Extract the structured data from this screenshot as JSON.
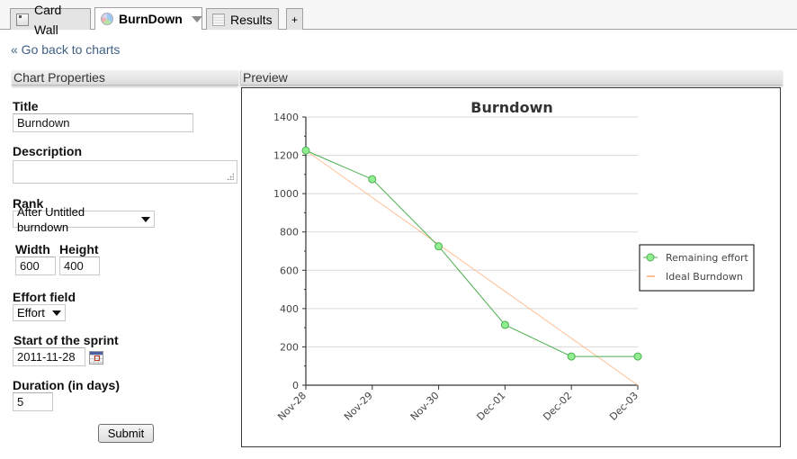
{
  "tabs": [
    {
      "label": "Card Wall",
      "icon": "card-icon",
      "active": false
    },
    {
      "label": "BurnDown",
      "icon": "pie-chart-icon",
      "active": true
    },
    {
      "label": "Results",
      "icon": "table-icon",
      "active": false
    },
    {
      "label": "+",
      "icon": "add-icon",
      "active": false
    }
  ],
  "back_link": "« Go back to charts",
  "sections": {
    "properties": "Chart Properties",
    "preview": "Preview"
  },
  "form": {
    "title_label": "Title",
    "title_value": "Burndown",
    "description_label": "Description",
    "description_value": "",
    "rank_label": "Rank",
    "rank_value": "After Untitled burndown",
    "width_label": "Width",
    "width_value": "600",
    "height_label": "Height",
    "height_value": "400",
    "effort_label": "Effort field",
    "effort_value": "Effort",
    "start_label": "Start of the sprint",
    "start_value": "2011-11-28",
    "duration_label": "Duration (in days)",
    "duration_value": "5",
    "submit_label": "Submit"
  },
  "colors": {
    "remaining": "#4caf50",
    "remaining_marker": "#90ee90",
    "ideal": "#ffbf94",
    "link": "#3f5f84"
  },
  "chart_data": {
    "type": "line",
    "title": "Burndown",
    "xlabel": "",
    "ylabel": "",
    "categories": [
      "Nov-28",
      "Nov-29",
      "Nov-30",
      "Dec-01",
      "Dec-02",
      "Dec-03"
    ],
    "ylim": [
      0,
      1400
    ],
    "yticks": [
      0,
      200,
      400,
      600,
      800,
      1000,
      1200,
      1400
    ],
    "grid": true,
    "legend_position": "right",
    "series": [
      {
        "name": "Remaining effort",
        "values": [
          1225,
          1075,
          725,
          315,
          150,
          150
        ],
        "markers": true
      },
      {
        "name": "Ideal Burndown",
        "values": [
          1225,
          980,
          735,
          490,
          245,
          0
        ],
        "markers": false
      }
    ]
  }
}
